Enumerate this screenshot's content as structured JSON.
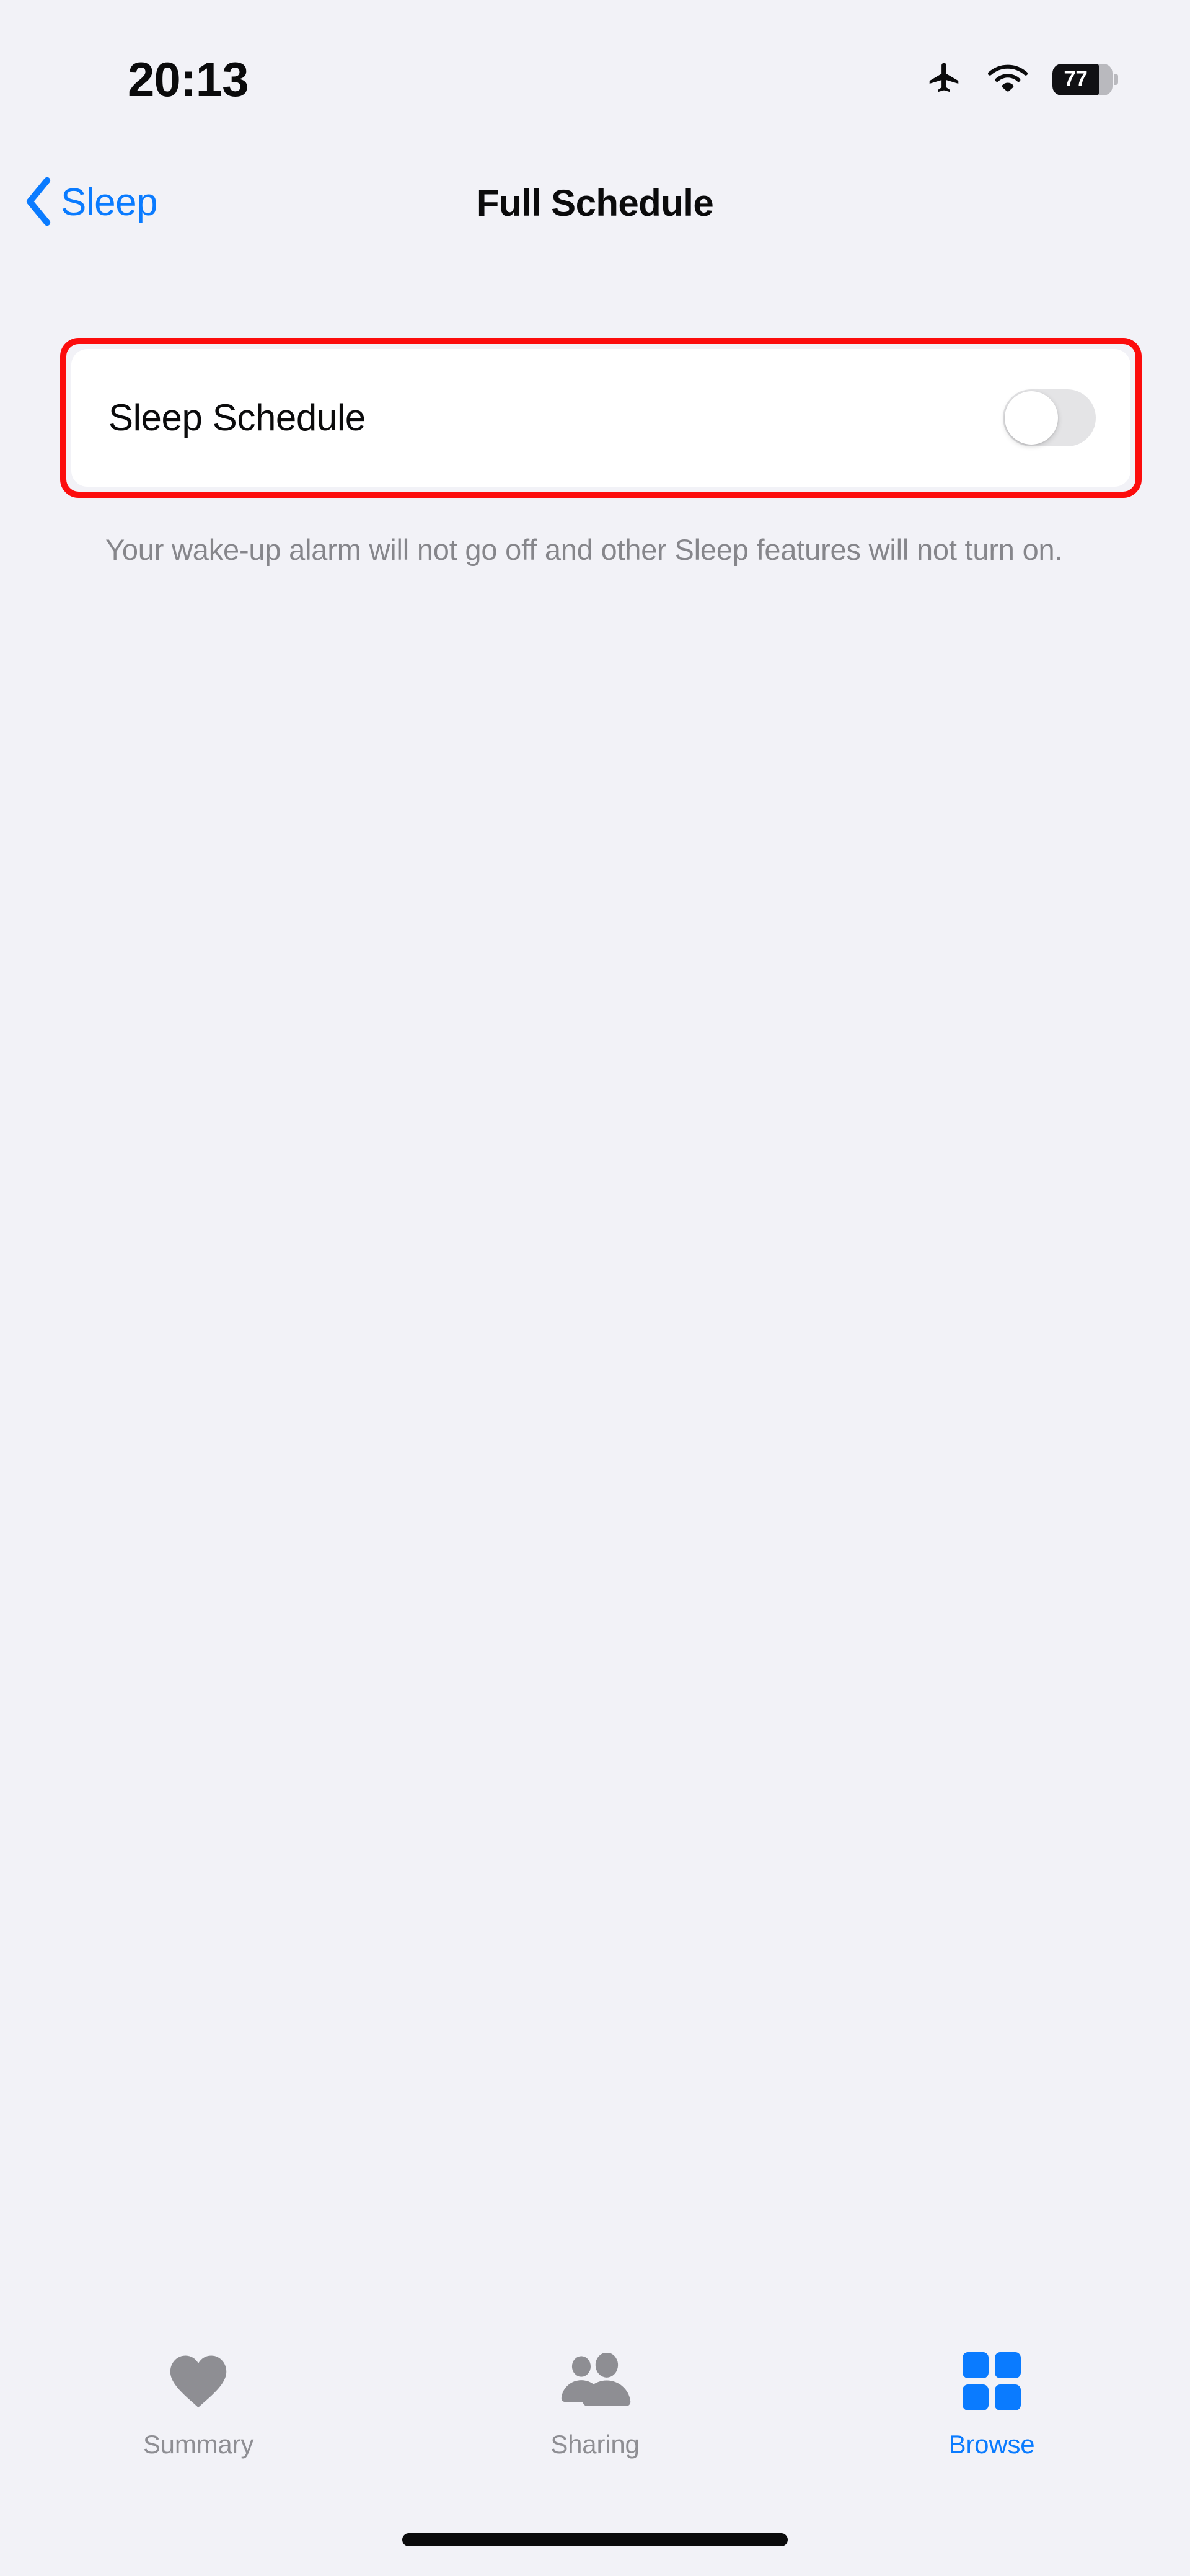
{
  "status_bar": {
    "time": "20:13",
    "battery_level": "77",
    "battery_percent": 77,
    "icons": [
      "airplane-mode-icon",
      "wifi-icon",
      "battery-icon"
    ]
  },
  "nav_bar": {
    "back_label": "Sleep",
    "back_icon": "chevron-left-icon",
    "title": "Full Schedule"
  },
  "main": {
    "schedule_row": {
      "label": "Sleep Schedule",
      "toggle_state": "off",
      "toggle_on": false
    },
    "footer_text": "Your wake-up alarm will not go off and other Sleep features will not turn on."
  },
  "annotation": {
    "highlight_color": "#FC0D0D",
    "target": "sleep-schedule-row"
  },
  "tab_bar": {
    "tabs": [
      {
        "label": "Summary",
        "icon": "heart-icon",
        "active": false
      },
      {
        "label": "Sharing",
        "icon": "people-icon",
        "active": false
      },
      {
        "label": "Browse",
        "icon": "grid-icon",
        "active": true
      }
    ]
  },
  "colors": {
    "background": "#F2F2F7",
    "card": "#FFFFFF",
    "accent_blue": "#0A7BFF",
    "inactive_grey": "#8E8E93",
    "secondary_text": "#86868B",
    "highlight_red": "#FC0D0D",
    "toggle_track_off": "#E4E4E6"
  }
}
